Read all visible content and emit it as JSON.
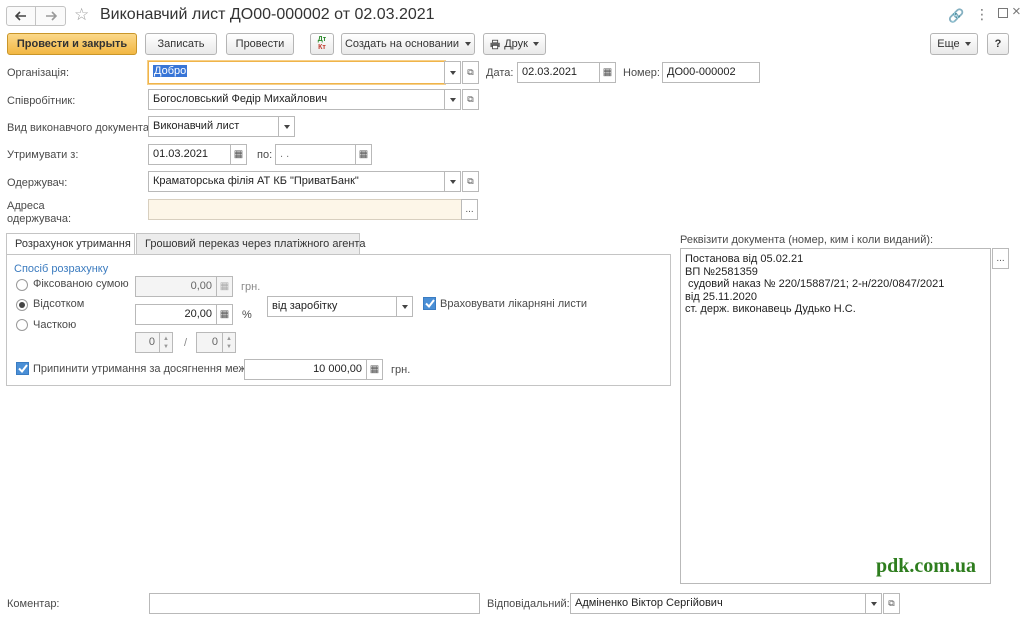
{
  "window": {
    "title": "Виконавчий лист ДО00-000002 от 02.03.2021"
  },
  "toolbar": {
    "post_close": "Провести и закрыть",
    "save": "Записать",
    "post": "Провести",
    "create_based": "Создать на основании",
    "print": "Друк",
    "more": "Еще",
    "help": "?"
  },
  "form": {
    "organization_label": "Організація:",
    "organization_value": "Добро",
    "date_label": "Дата:",
    "date_value": "02.03.2021",
    "number_label": "Номер:",
    "number_value": "ДО00-000002",
    "employee_label": "Співробітник:",
    "employee_value": "Богословський Федір Михайлович",
    "doc_type_label": "Вид виконавчого документа:",
    "doc_type_value": "Виконавчий лист",
    "withhold_from_label": "Утримувати з:",
    "withhold_from_value": "01.03.2021",
    "to_label": "по:",
    "to_value": " .  .",
    "recipient_label": "Одержувач:",
    "recipient_value": "Краматорська філія АТ КБ \"ПриватБанк\"",
    "recipient_address_label_1": "Адреса",
    "recipient_address_label_2": "одержувача:",
    "recipient_address_value": "",
    "ellipsis": "..."
  },
  "tabs": [
    {
      "label": "Розрахунок утримання"
    },
    {
      "label": "Грошовий переказ через платіжного агента"
    }
  ],
  "calc": {
    "method_title": "Спосіб розрахунку",
    "fixed_label": "Фіксованою сумою",
    "fixed_value": "0,00",
    "fixed_unit": "грн.",
    "percent_label": "Відсотком",
    "percent_value": "20,00",
    "percent_unit": "%",
    "base_value": "від заробітку",
    "sick_label": "Враховувати лікарняні листи",
    "part_label": "Часткою",
    "part_num": "0",
    "part_slash": "/",
    "part_den": "0",
    "stop_label": "Припинити утримання за досягнення межі",
    "stop_value": "10 000,00",
    "stop_unit": "грн."
  },
  "requisites": {
    "label": "Реквізити документа (номер, ким і коли виданий):",
    "lines": [
      "Постанова від 05.02.21",
      "ВП №2581359",
      " судовий наказ № 220/15887/21; 2-н/220/0847/2021",
      "від 25.11.2020",
      "ст. держ. виконавець Дудько Н.С."
    ]
  },
  "footer": {
    "comment_label": "Коментар:",
    "comment_value": "",
    "responsible_label": "Відповідальний:",
    "responsible_value": "Адміненко Віктор Сергійович"
  },
  "watermark": "pdk.com.ua",
  "colors": {
    "accent": "#f2b743",
    "link_blue": "#3b7bbf",
    "watermark": "#2e7d1e"
  }
}
